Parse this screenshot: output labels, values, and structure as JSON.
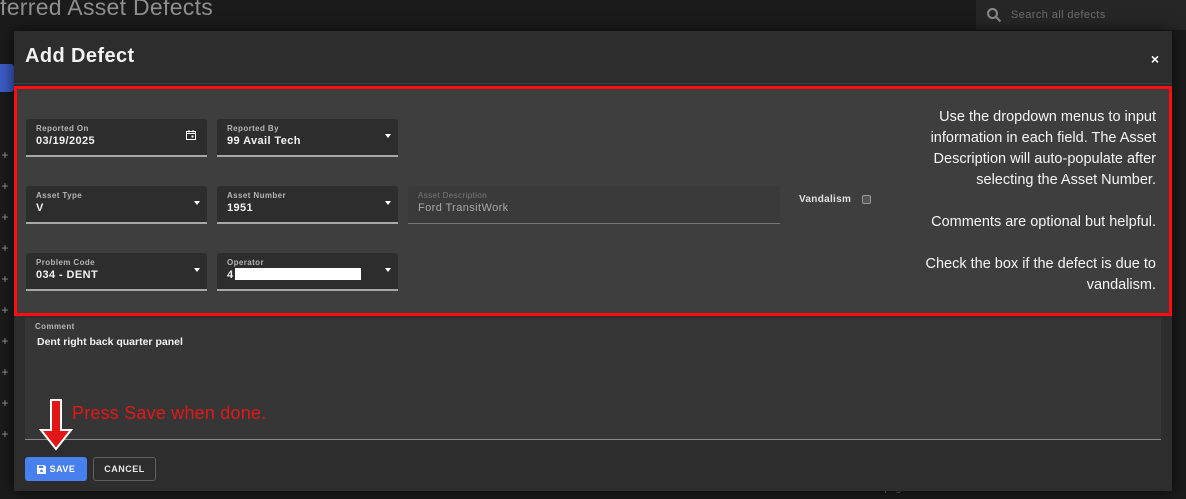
{
  "background": {
    "page_title": "ferred Asset Defects",
    "search_placeholder": "Search all defects",
    "plus_glyph": "+",
    "footer_text": "Per page"
  },
  "modal": {
    "title": "Add Defect",
    "close_glyph": "×",
    "fields": {
      "reported_on": {
        "label": "Reported On",
        "value": "03/19/2025"
      },
      "reported_by": {
        "label": "Reported By",
        "value": "99 Avail Tech"
      },
      "asset_type": {
        "label": "Asset Type",
        "value": "V"
      },
      "asset_number": {
        "label": "Asset Number",
        "value": "1951"
      },
      "asset_description": {
        "label": "Asset Description",
        "value": "Ford TransitWork"
      },
      "problem_code": {
        "label": "Problem Code",
        "value": "034 - DENT"
      },
      "operator": {
        "label": "Operator",
        "value": "4"
      },
      "comment": {
        "label": "Comment",
        "value": "Dent right back quarter panel"
      }
    },
    "vandalism_label": "Vandalism",
    "vandalism_checked": false,
    "save_label": "SAVE",
    "cancel_label": "CANCEL"
  },
  "instructions": {
    "paragraph1": "Use the dropdown menus to input information in each field. The Asset Description will auto-populate after selecting the Asset Number.",
    "paragraph2": "Comments are optional but helpful.",
    "paragraph3": "Check the box if the defect is due to vandalism."
  },
  "annotation": {
    "text": "Press Save when done.",
    "color": "#e21818"
  },
  "colors": {
    "accent": "#4880f0",
    "highlight_border": "#ff0d0d",
    "modal_bg": "#2d2d2d"
  }
}
